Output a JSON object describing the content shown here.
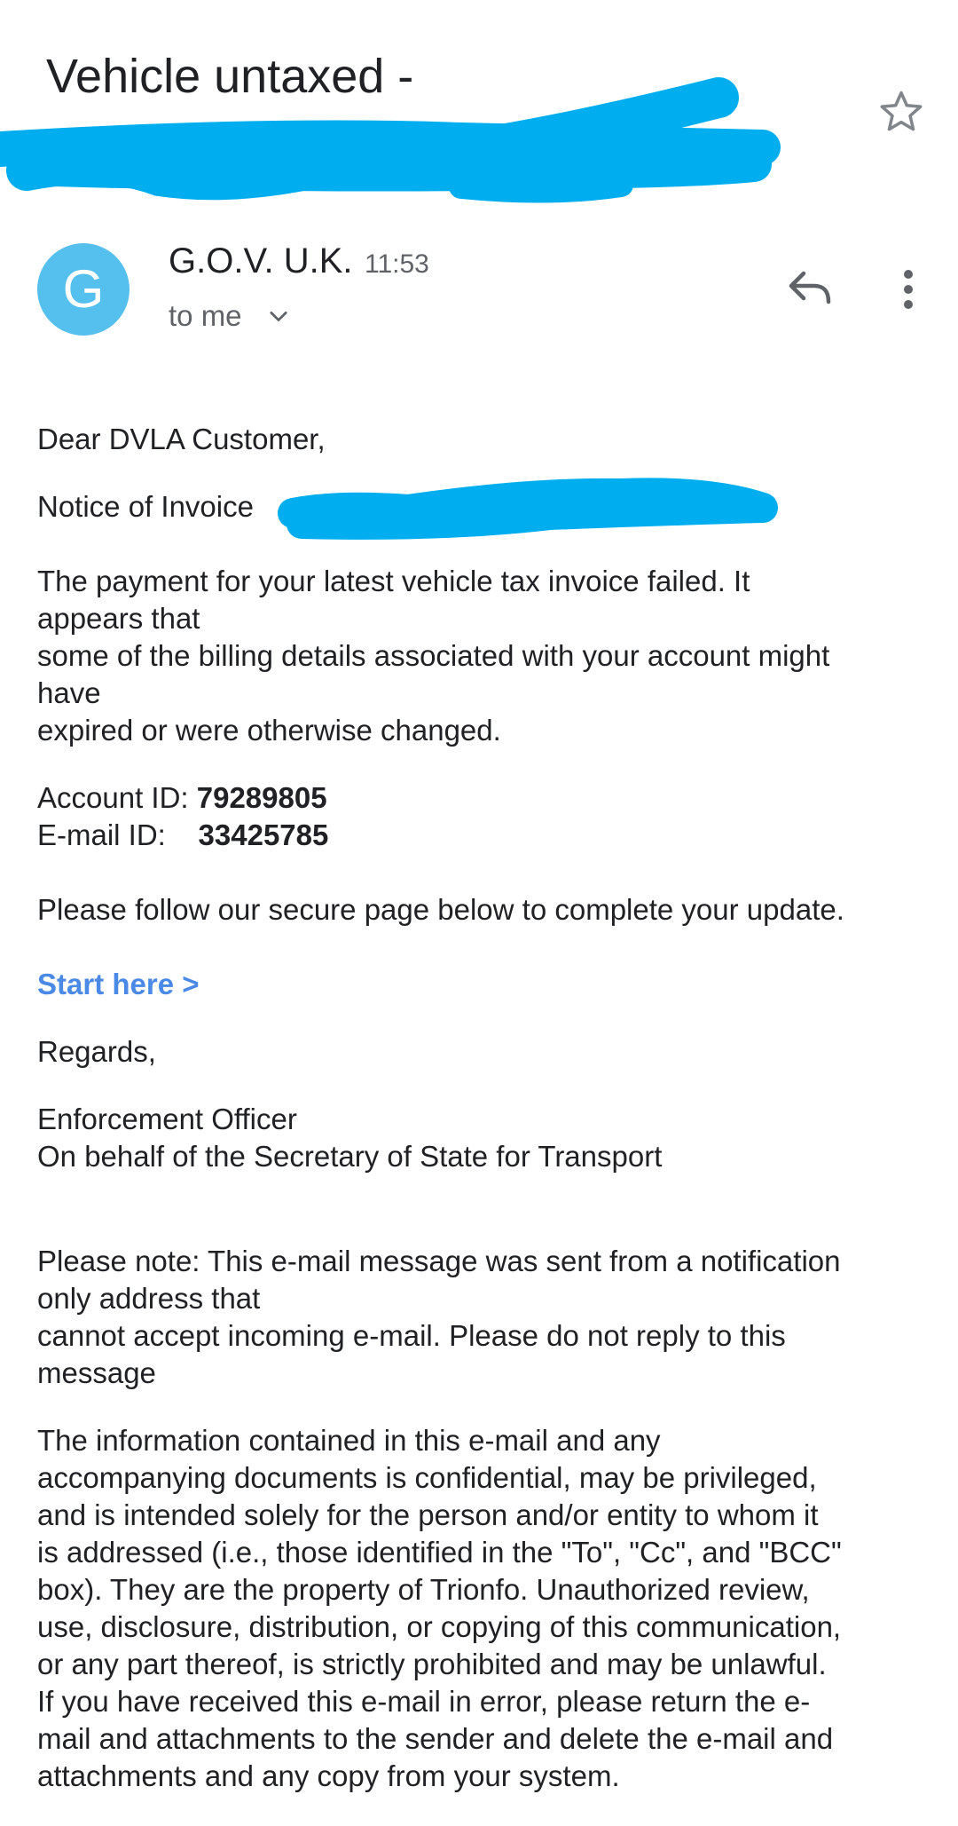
{
  "email": {
    "subject": "Vehicle untaxed -",
    "sender_name": "G.O.V. U.K.",
    "sender_initial": "G",
    "time": "11:53",
    "recipient": "to me",
    "greeting": "Dear DVLA Customer,",
    "invoice_label": "Notice of Invoice",
    "paragraph1": [
      "The payment for your latest vehicle tax invoice failed. It",
      "appears that",
      "some of the billing details associated with your account might",
      "have",
      "expired or were otherwise changed."
    ],
    "account_id_label": "Account ID:",
    "account_id_value": "79289805",
    "email_id_label": "E-mail ID:",
    "email_id_value": "33425785",
    "instruction": "Please follow our secure page below to complete your update.",
    "link_label": "Start here >",
    "regards": "Regards,",
    "signature_title": "Enforcement Officer",
    "signature_org": "On behalf of the Secretary of State for Transport",
    "note": [
      "Please note: This e-mail message was sent from a notification",
      "only address that",
      "cannot accept incoming e-mail. Please do not reply to this",
      "message"
    ],
    "disclaimer": [
      "The information contained in this e-mail and any",
      "accompanying documents is confidential, may be privileged,",
      "and is intended solely for the person and/or entity to whom it",
      "is addressed (i.e., those identified in the \"To\", \"Cc\", and \"BCC\"",
      "box). They are the property of Trionfo. Unauthorized review,",
      "use, disclosure, distribution, or copying of this communication,",
      "or any part thereof, is strictly prohibited and may be unlawful.",
      "If you have received this e-mail in error, please return the e-",
      "mail and attachments to the sender and delete the e-mail and",
      "attachments and any copy from your system."
    ]
  },
  "icons": {
    "star": "star-icon",
    "reply": "reply-icon",
    "more": "more-vert-icon",
    "chevron": "chevron-down-icon"
  },
  "colors": {
    "avatar": "#55bfee",
    "link": "#4a8ae6",
    "redaction": "#00aeef",
    "text": "#202124",
    "secondary": "#5f6368"
  }
}
